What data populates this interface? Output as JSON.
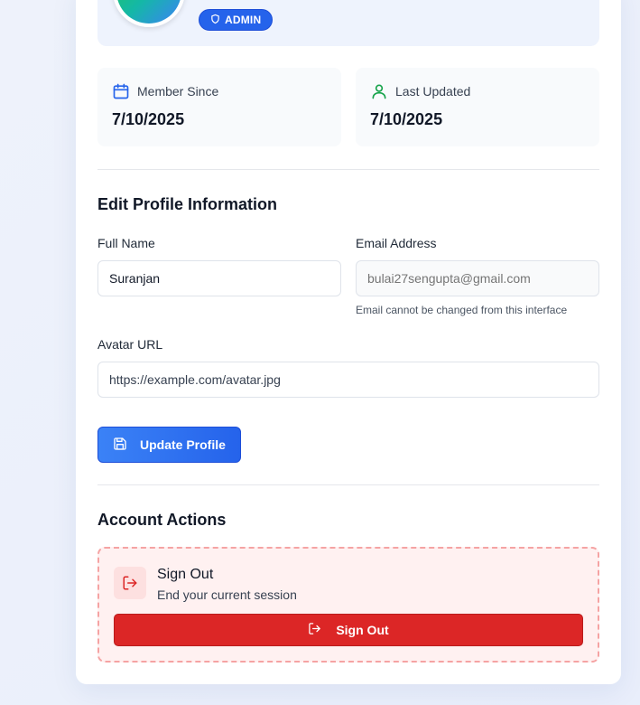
{
  "profile": {
    "role_badge": "ADMIN"
  },
  "stats": {
    "member_since_label": "Member Since",
    "member_since_value": "7/10/2025",
    "last_updated_label": "Last Updated",
    "last_updated_value": "7/10/2025"
  },
  "edit_profile": {
    "title": "Edit Profile Information",
    "full_name_label": "Full Name",
    "full_name_value": "Suranjan",
    "email_label": "Email Address",
    "email_placeholder": "bulai27sengupta@gmail.com",
    "email_hint": "Email cannot be changed from this interface",
    "avatar_label": "Avatar URL",
    "avatar_value": "https://example.com/avatar.jpg",
    "update_button": "Update Profile"
  },
  "account_actions": {
    "title": "Account Actions",
    "sign_out_title": "Sign Out",
    "sign_out_subtitle": "End your current session",
    "sign_out_button": "Sign Out"
  },
  "colors": {
    "primary": "#2563eb",
    "danger": "#dc2626",
    "success": "#16a34a"
  }
}
